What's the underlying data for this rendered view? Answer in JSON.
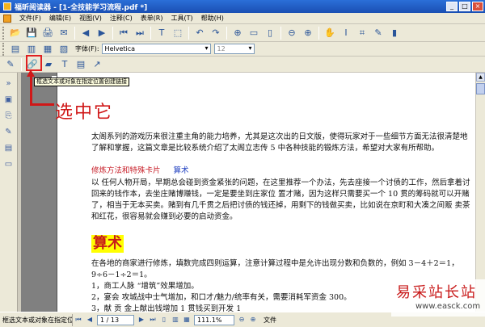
{
  "window": {
    "title": "福昕阅读器 - [1-全技能学习流程.pdf *]",
    "min": "_",
    "max": "□",
    "close": "×"
  },
  "menu": [
    "文件(F)",
    "编辑(E)",
    "视图(V)",
    "注释(C)",
    "表单(R)",
    "工具(T)",
    "帮助(H)"
  ],
  "font_toolbar": {
    "label": "字体(F):",
    "font_value": "Helvetica",
    "size_value": "12"
  },
  "tooltip": "框选文本或对象在指定位置创建链接",
  "callout": "选中它",
  "document": {
    "para1": "太阁系列的游戏历来很注重主角的能力培养，尤其是这次出的日文版，使得玩家对于一些细节方面无法很清楚地了解和掌握，这篇文章是比较系统介绍了太阁立志传 5 中各种技能的锻炼方法，希望对大家有所帮助。",
    "link_red": "修炼方法和特殊卡片",
    "link_blue": "算术",
    "para2": "以 任何人物开局，早期总会碰到资金紧张的问题，在这里推荐一个办法，先去座接一个讨债的工作，然后拿着讨回来的钱作本，去坐庄赌博赚钱，一定是要坐到庄家位 置才赌，因为这样只需要买一个 10 贯的筹码就可以开赌了，相当于无本买卖。赌到有几千贯之后把讨债的钱还掉，用剩下的钱做买卖，比如说在京町和大凑之间贩 卖茶和红花，很容易就会赚到必要的启动资金。",
    "heading": "算术",
    "para3": "在各地的商家进行修炼，填数完成四则运算，注意计算过程中是允许出现分数和负数的，例如 3－4＋2＝1，9÷6－1÷2＝1。",
    "item1": "1，商工人脉 “增筑”效果增加。",
    "item2": "2，宴会 攻城战中士气增加，和口才/魅力/统率有关，需要消耗军资金 300。",
    "item3": "3，献 贡 金上献出钱增加 1 贯钱买到开发 1"
  },
  "status": {
    "hint": "框选文本或对象在指定位置创建链接",
    "page": "1 / 13",
    "zoom": "111.1%",
    "right_label": "文件"
  },
  "watermark": {
    "title": "易采站长站",
    "url": "www.easck.com"
  }
}
